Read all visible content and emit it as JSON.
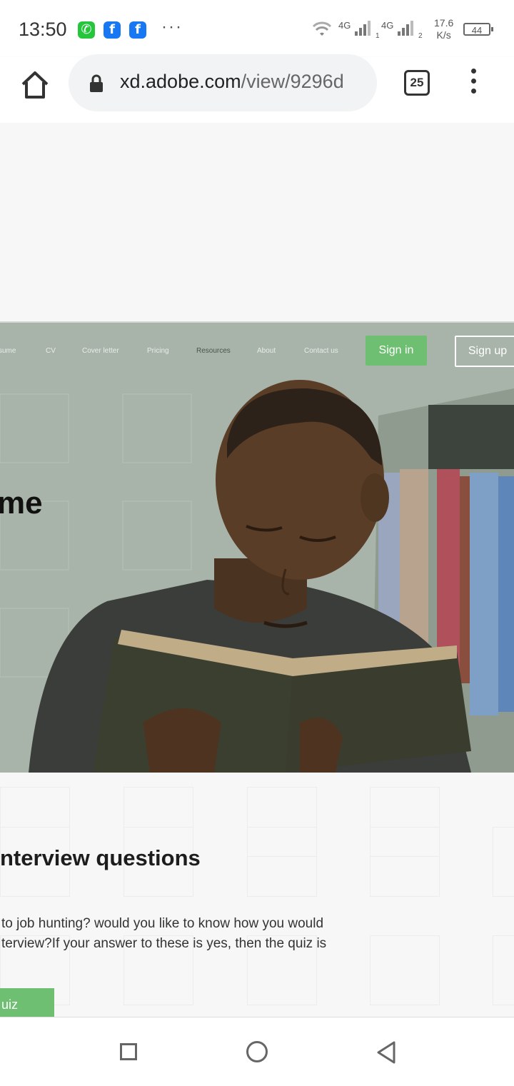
{
  "status_bar": {
    "time": "13:50",
    "network_1": "4G",
    "network_1_sim": "1",
    "network_2": "4G",
    "network_2_sim": "2",
    "speed_value": "17.6",
    "speed_unit": "K/s",
    "battery": "44",
    "notification_icons": [
      "whatsapp-icon",
      "facebook-icon",
      "facebook-icon"
    ]
  },
  "browser": {
    "url_host": "xd.adobe.com",
    "url_path": "/view/9296d",
    "tab_count": "25"
  },
  "site_nav": {
    "links": [
      "sume",
      "CV",
      "Cover letter",
      "Pricing",
      "Resources",
      "About",
      "Contact us"
    ],
    "active": "Resources",
    "sign_in": "Sign in",
    "sign_up": "Sign up",
    "accent": "#6fbf73"
  },
  "hero": {
    "heading_fragment": "me"
  },
  "section": {
    "title": "nterview questions",
    "paragraph": "to job hunting? would you like to know how you would terview?If your answer to these is yes, then the quiz is",
    "button": "uiz"
  }
}
